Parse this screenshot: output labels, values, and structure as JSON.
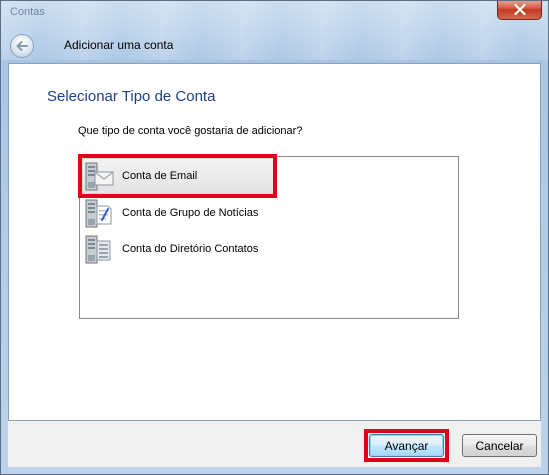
{
  "window": {
    "title": "Contas"
  },
  "header": {
    "back_label": "Voltar",
    "dialog_title": "Adicionar uma conta"
  },
  "main": {
    "heading": "Selecionar Tipo de Conta",
    "question": "Que tipo de conta você gostaria de adicionar?",
    "account_types": [
      {
        "label": "Conta de Email",
        "icon": "email-server-icon",
        "selected": true
      },
      {
        "label": "Conta de Grupo de Notícias",
        "icon": "newsgroup-server-icon",
        "selected": false
      },
      {
        "label": "Conta do Diretório Contatos",
        "icon": "directory-server-icon",
        "selected": false
      }
    ]
  },
  "footer": {
    "next_label": "Avançar",
    "cancel_label": "Cancelar"
  },
  "colors": {
    "heading": "#1e3f8a",
    "highlight": "#e0001a",
    "close_button": "#c03a1d"
  }
}
